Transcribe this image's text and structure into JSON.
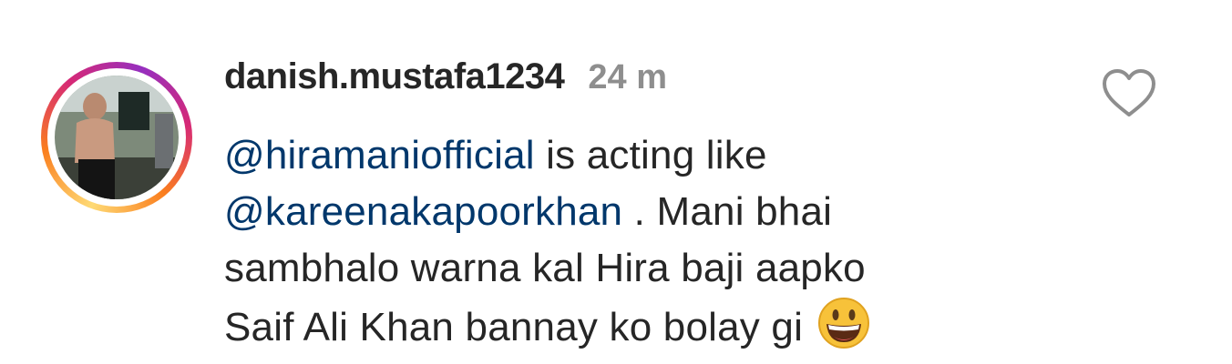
{
  "comment": {
    "username": "danish.mustafa1234",
    "timestamp": "24 m",
    "mention_1": "@hiramaniofficial",
    "text_1": " is acting like",
    "mention_2": "@kareenakapoorkhan",
    "text_2": " . Mani bhai",
    "text_3": "sambhalo warna kal Hira baji aapko",
    "text_4": "Saif Ali Khan bannay ko bolay gi ",
    "emoji": "grinning-face-emoji",
    "like_icon": "heart-outline-icon"
  },
  "colors": {
    "mention": "#00376b",
    "text": "#262626",
    "muted": "#8e8e8e"
  }
}
